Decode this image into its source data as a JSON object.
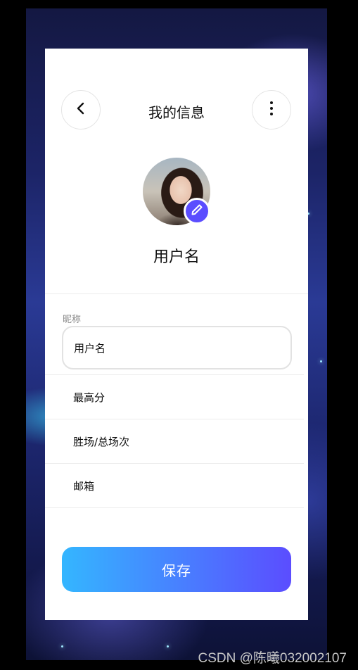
{
  "header": {
    "title": "我的信息"
  },
  "profile": {
    "username": "用户名"
  },
  "form": {
    "nickname_label": "昵称",
    "nickname_value": "用户名",
    "rows": [
      {
        "label": "最高分"
      },
      {
        "label": "胜场/总场次"
      },
      {
        "label": "邮箱"
      }
    ],
    "save_label": "保存"
  },
  "icons": {
    "back": "chevron-left-icon",
    "more": "more-vertical-icon",
    "edit": "pencil-icon"
  },
  "colors": {
    "accent": "#5b4dff",
    "gradient_start": "#34b6ff",
    "gradient_end": "#5b4dff"
  },
  "watermark": "CSDN @陈曦032002107"
}
